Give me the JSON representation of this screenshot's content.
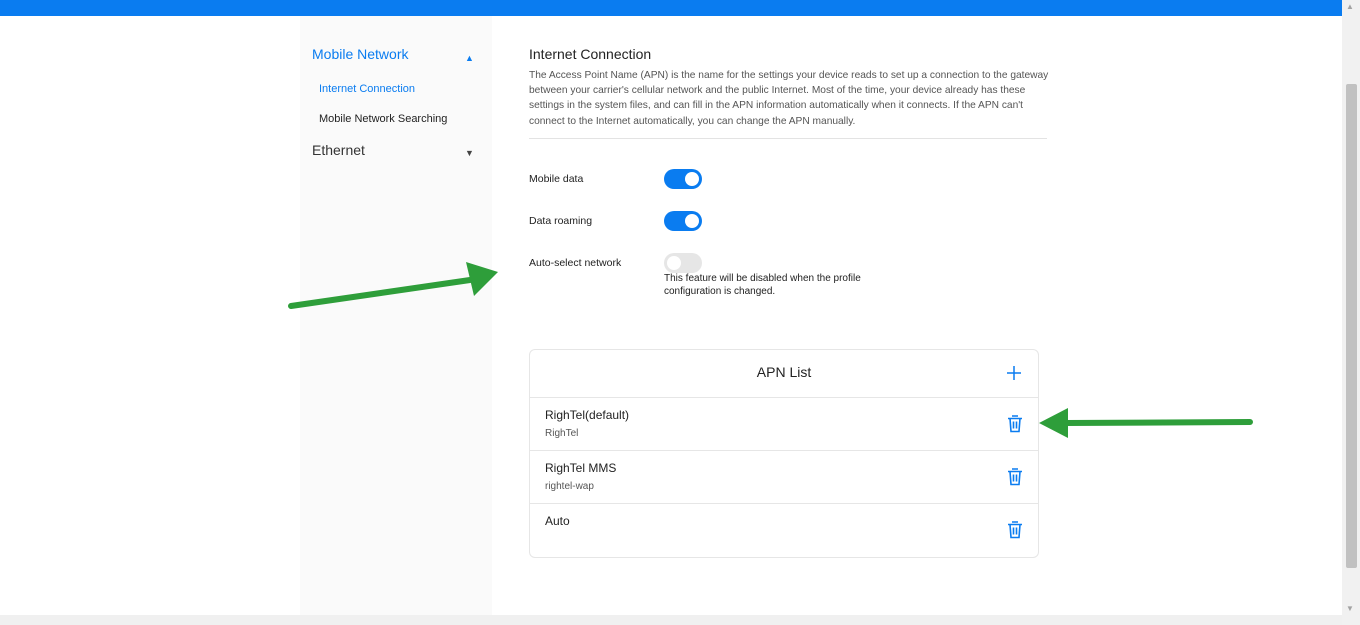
{
  "sidebar": {
    "groups": [
      {
        "label": "Mobile Network",
        "expanded": true
      },
      {
        "label": "Ethernet",
        "expanded": false
      }
    ],
    "items": [
      {
        "label": "Internet Connection",
        "active": true
      },
      {
        "label": "Mobile Network Searching",
        "active": false
      }
    ]
  },
  "main": {
    "title": "Internet Connection",
    "description": "The Access Point Name (APN) is the name for the settings your device reads to set up a connection to the gateway between your carrier's cellular network and the public Internet. Most of the time, your device already has these settings in the system files, and can fill in the APN information automatically when it connects. If the APN can't connect to the Internet automatically, you can change the APN manually.",
    "settings": [
      {
        "label": "Mobile data",
        "enabled": true
      },
      {
        "label": "Data roaming",
        "enabled": true
      },
      {
        "label": "Auto-select network",
        "enabled": false
      }
    ],
    "auto_select_hint": "This feature will be disabled when the profile configuration is changed."
  },
  "apn_list": {
    "title": "APN List",
    "add_icon": "plus-icon",
    "delete_icon": "trash-icon",
    "items": [
      {
        "name": "RighTel(default)",
        "apn": "RighTel"
      },
      {
        "name": "RighTel MMS",
        "apn": "rightel-wap"
      },
      {
        "name": "Auto",
        "apn": ""
      }
    ]
  },
  "colors": {
    "accent": "#0a7cf0",
    "annotation_arrow": "#2e9e3a"
  }
}
